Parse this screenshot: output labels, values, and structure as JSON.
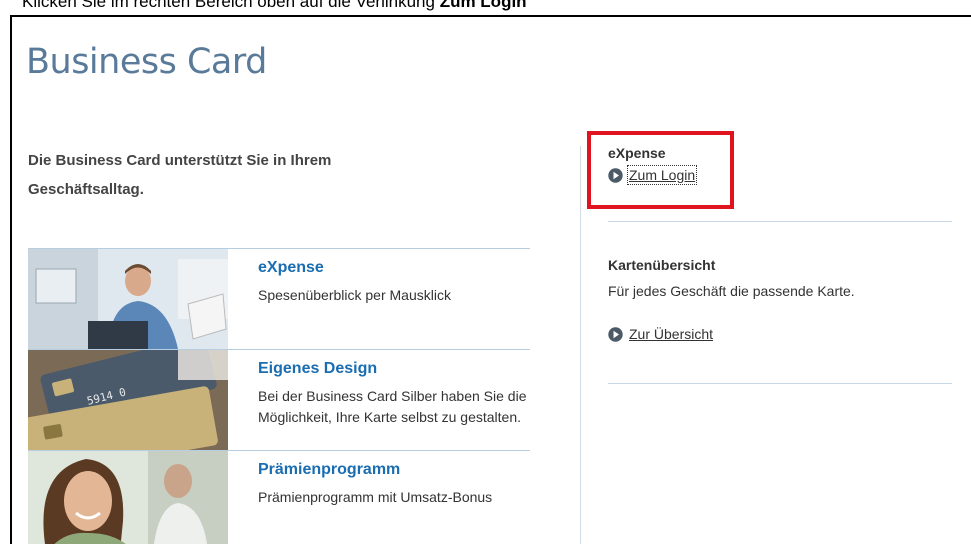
{
  "instruction": {
    "prefix": "Klicken Sie im rechten Bereich oben auf die Verlinkung ",
    "bold": "Zum Login"
  },
  "page": {
    "title": "Business Card",
    "intro": "Die Business Card unterstützt Sie in Ihrem Geschäftsalltag."
  },
  "features": [
    {
      "title": "eXpense",
      "description": "Spesenüberblick per Mausklick",
      "image": "man-at-desk-photo"
    },
    {
      "title": "Eigenes Design",
      "description": "Bei der Business Card Silber haben Sie die Möglichkeit, Ihre Karte selbst zu gestalten.",
      "image": "credit-cards-photo"
    },
    {
      "title": "Prämienprogramm",
      "description": "Prämienprogramm mit Umsatz-Bonus",
      "image": "smiling-woman-photo"
    }
  ],
  "sidebar": {
    "expense": {
      "heading": "eXpense",
      "link": "Zum Login"
    },
    "overview": {
      "heading": "Kartenübersicht",
      "text": "Für jedes Geschäft die passende Karte.",
      "link": "Zur Übersicht"
    }
  },
  "colors": {
    "title": "#5a7a99",
    "feature_title": "#1a6db0",
    "highlight": "#e0141e",
    "divider": "#b7cde0"
  },
  "icons": [
    "arrow-circle-icon"
  ]
}
